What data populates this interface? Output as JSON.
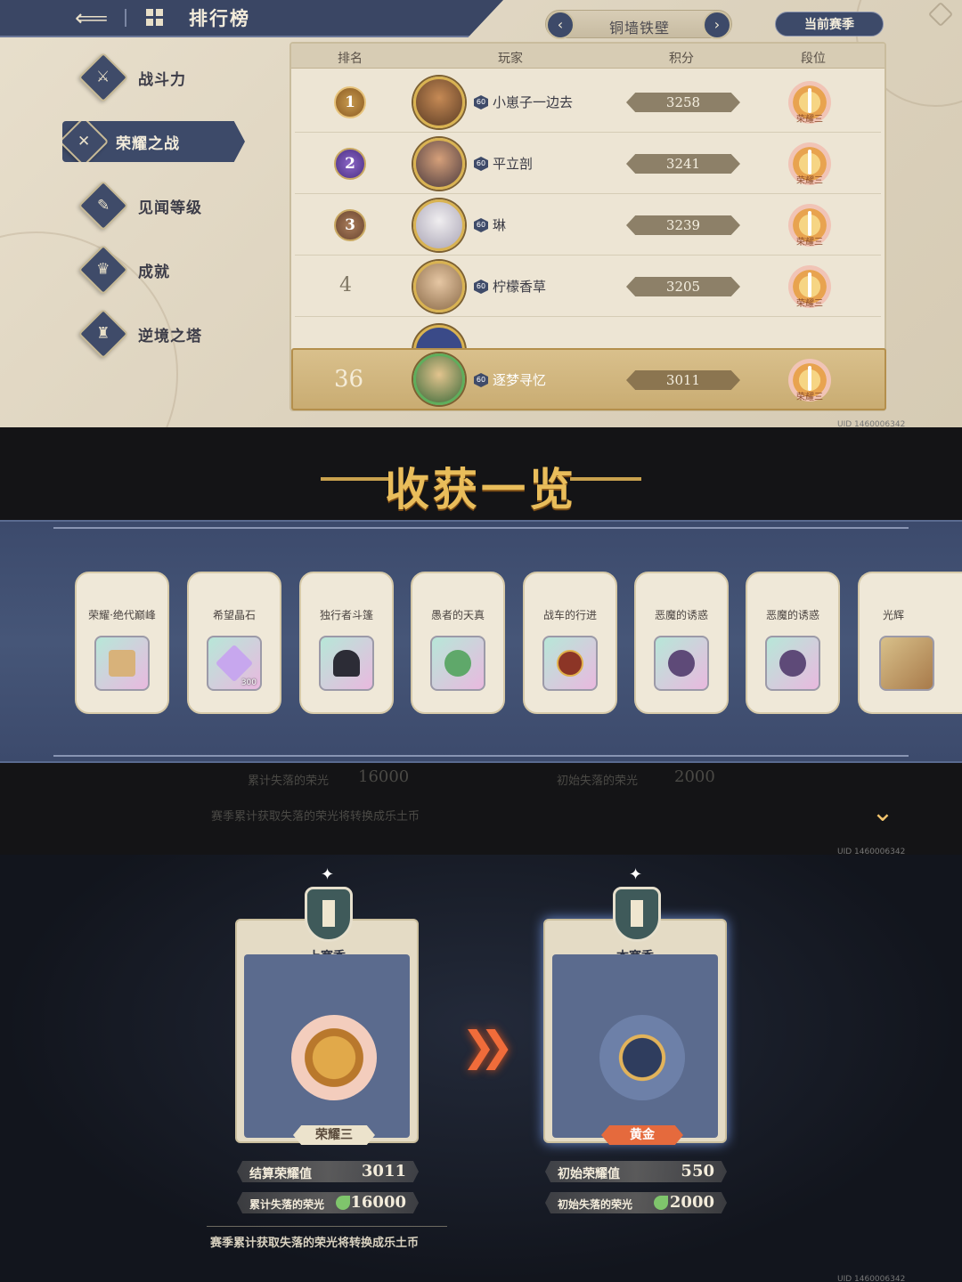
{
  "header": {
    "title": "排行榜",
    "back_icon": "back-arrow-icon",
    "menu_icon": "grid-menu-icon"
  },
  "season_selector": {
    "name": "铜墙铁壁",
    "current_label": "当前赛季"
  },
  "sidebar": {
    "items": [
      {
        "label": "战斗力",
        "icon": "crossed-swords-icon"
      },
      {
        "label": "荣耀之战",
        "icon": "crossed-blades-icon",
        "active": true
      },
      {
        "label": "见闻等级",
        "icon": "scroll-icon"
      },
      {
        "label": "成就",
        "icon": "trophy-icon"
      },
      {
        "label": "逆境之塔",
        "icon": "tower-icon"
      }
    ]
  },
  "table": {
    "headers": [
      "排名",
      "玩家",
      "积分",
      "段位"
    ],
    "rows": [
      {
        "rank": "1",
        "player": "小崽子一边去",
        "level": "60",
        "score": "3258",
        "tier": "荣耀三"
      },
      {
        "rank": "2",
        "player": "平立剖",
        "level": "60",
        "score": "3241",
        "tier": "荣耀三"
      },
      {
        "rank": "3",
        "player": "琳",
        "level": "60",
        "score": "3239",
        "tier": "荣耀三"
      },
      {
        "rank": "4",
        "player": "柠檬香草",
        "level": "60",
        "score": "3205",
        "tier": "荣耀三"
      }
    ],
    "my_row": {
      "rank": "36",
      "player": "逐梦寻忆",
      "level": "60",
      "score": "3011",
      "tier": "荣耀三"
    }
  },
  "uid": "UID 1460006342",
  "harvest": {
    "title": "收获一览",
    "items": [
      {
        "name": "荣耀·绝代巅峰",
        "qty": ""
      },
      {
        "name": "希望晶石",
        "qty": "300"
      },
      {
        "name": "独行者斗篷",
        "qty": ""
      },
      {
        "name": "愚者的天真",
        "qty": ""
      },
      {
        "name": "战车的行进",
        "qty": ""
      },
      {
        "name": "恶魔的诱惑",
        "qty": ""
      },
      {
        "name": "恶魔的诱惑",
        "qty": ""
      },
      {
        "name": "光辉",
        "qty": ""
      }
    ]
  },
  "season_compare": {
    "last": {
      "caption": "上赛季",
      "tier": "荣耀三"
    },
    "current": {
      "caption": "本赛季",
      "tier": "黄金"
    },
    "stats_left": [
      {
        "label": "结算荣耀值",
        "value": "3011"
      },
      {
        "label": "累计失落的荣光",
        "value": "16000"
      }
    ],
    "stats_right": [
      {
        "label": "初始荣耀值",
        "value": "550"
      },
      {
        "label": "初始失落的荣光",
        "value": "2000"
      }
    ],
    "note": "赛季累计获取失落的荣光将转换成乐土币"
  },
  "colors": {
    "navy": "#3d4a69",
    "gold": "#e9bd5b",
    "cream": "#efe8d8",
    "arrow_orange": "#f06c3a"
  }
}
